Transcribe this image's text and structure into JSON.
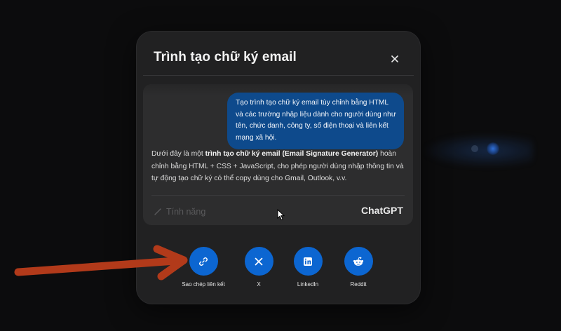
{
  "modal": {
    "title": "Trình tạo chữ ký email",
    "close_icon": "close-icon"
  },
  "preview": {
    "user_message": "Tạo trình tạo chữ ký email tùy chỉnh bằng HTML và các trường nhập liệu dành cho người dùng như tên, chức danh, công ty, số điện thoại và liên kết mạng xã hội.",
    "answer_prefix": "Dưới đây là một ",
    "answer_bold": "trình tạo chữ ký email (Email Signature Generator)",
    "answer_suffix": " hoàn chỉnh bằng HTML + CSS + JavaScript, cho phép người dùng nhập thông tin và tự động tạo chữ ký có thể copy dùng cho Gmail, Outlook, v.v.",
    "feature_label": "Tính năng",
    "brand": "ChatGPT"
  },
  "share": [
    {
      "label": "Sao chép liên kết",
      "icon": "link-icon"
    },
    {
      "label": "X",
      "icon": "x-logo-icon"
    },
    {
      "label": "LinkedIn",
      "icon": "linkedin-icon"
    },
    {
      "label": "Reddit",
      "icon": "reddit-icon"
    }
  ],
  "colors": {
    "modal_bg": "#212122",
    "bubble_bg": "#0e4a8c",
    "share_button": "#0c66d1",
    "annotation_arrow": "#b23a1a"
  }
}
